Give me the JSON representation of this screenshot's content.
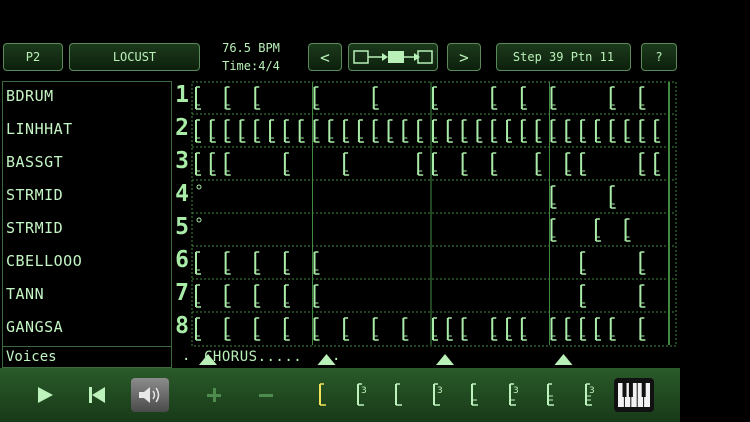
{
  "header": {
    "part_button": "P2",
    "pattern_name": "LOCUST",
    "bpm": "76.5 BPM",
    "time_sig": "Time:4/4",
    "prev_label": "<",
    "next_label": ">",
    "step_info": "Step 39 Ptn 11",
    "help_label": "?"
  },
  "voices": [
    "BDRUM",
    "LINHHAT",
    "BASSGT",
    "STRMID",
    "STRMID",
    "CBELLOOO",
    "TANN",
    "GANGSA"
  ],
  "row_numbers": [
    "1",
    "2",
    "3",
    "4",
    "5",
    "6",
    "7",
    "8"
  ],
  "voices_label": "Voices",
  "sections": {
    "chorus_label": "CHORUS.....",
    "chorus_dots": ".",
    "marker_steps": [
      1,
      9,
      17,
      25
    ]
  },
  "sequence": {
    "steps": 32,
    "notes": [
      [
        1,
        3,
        5,
        9,
        13,
        17,
        21,
        23,
        25,
        29,
        31
      ],
      [
        1,
        2,
        3,
        4,
        5,
        6,
        7,
        8,
        9,
        10,
        11,
        12,
        13,
        14,
        15,
        16,
        17,
        18,
        19,
        20,
        21,
        22,
        23,
        24,
        25,
        26,
        27,
        28,
        29,
        30,
        31,
        32
      ],
      [
        1,
        2,
        3,
        7,
        11,
        16,
        17,
        19,
        21,
        24,
        26,
        27,
        31,
        32
      ],
      [
        25,
        29
      ],
      [
        25,
        28,
        30
      ],
      [
        1,
        3,
        5,
        7,
        9,
        27,
        31
      ],
      [
        1,
        3,
        5,
        7,
        9,
        27,
        31
      ],
      [
        1,
        3,
        5,
        7,
        9,
        11,
        13,
        15,
        17,
        18,
        19,
        21,
        22,
        23,
        25,
        26,
        27,
        28,
        29,
        31
      ]
    ],
    "rests": [
      4,
      5
    ]
  },
  "toolbar": {
    "icons": [
      "play-icon",
      "skip-back-icon",
      "speaker-icon",
      "plus-icon",
      "minus-icon",
      "note-whole-icon",
      "note-triplet-half-icon",
      "note-half-icon",
      "note-triplet-quarter-icon",
      "note-quarter-icon",
      "note-triplet-eighth-icon",
      "note-eighth-icon",
      "note-triplet-sixteenth-icon",
      "piano-keyboard-icon"
    ],
    "triplet_mark": "3"
  },
  "colors": {
    "background": "#000000",
    "text": "#b8f0b8",
    "grid_line": "#3f8a3f",
    "note": "#a8eca8",
    "active_note": "#f2e25a",
    "bottom_bar": "#22502a"
  }
}
